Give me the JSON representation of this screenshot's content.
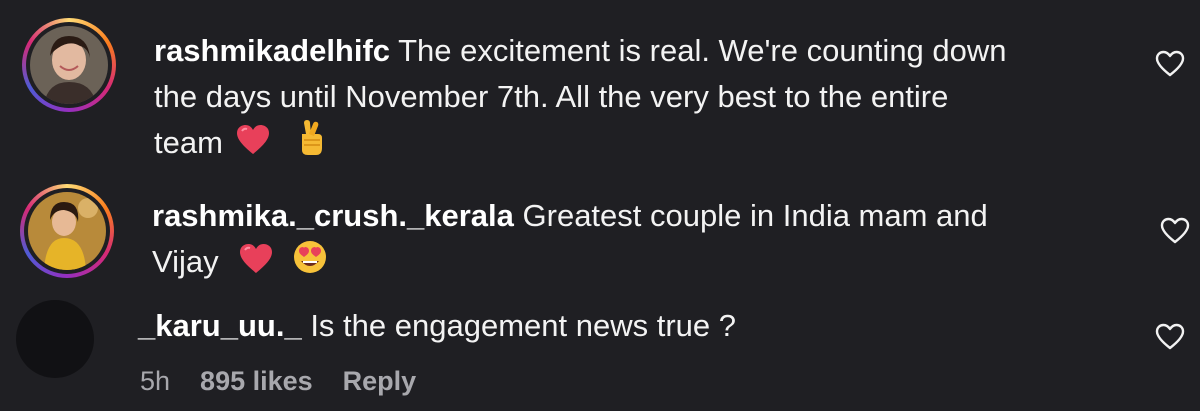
{
  "comments": [
    {
      "username": "rashmikadelhifc",
      "text_line1": " The excitement is real. We're counting down",
      "text_line2": "the days until November 7th. All the very best to the entire",
      "text_line3": "team",
      "emojis": [
        "red-heart",
        "crossed-fingers"
      ]
    },
    {
      "username": "rashmika._crush._kerala",
      "text_line1": " Greatest couple in India mam and",
      "text_line2": "Vijay",
      "emojis": [
        "red-heart",
        "heart-eyes"
      ]
    },
    {
      "username": "_karu_uu._",
      "text_line1": " Is the engagement news true ?",
      "meta": {
        "time": "5h",
        "likes": "895 likes",
        "reply": "Reply"
      }
    }
  ],
  "colors": {
    "background": "#1f1f23",
    "text": "#f3f3f3",
    "meta": "#a8a8ad",
    "heart": "#e8405a"
  }
}
